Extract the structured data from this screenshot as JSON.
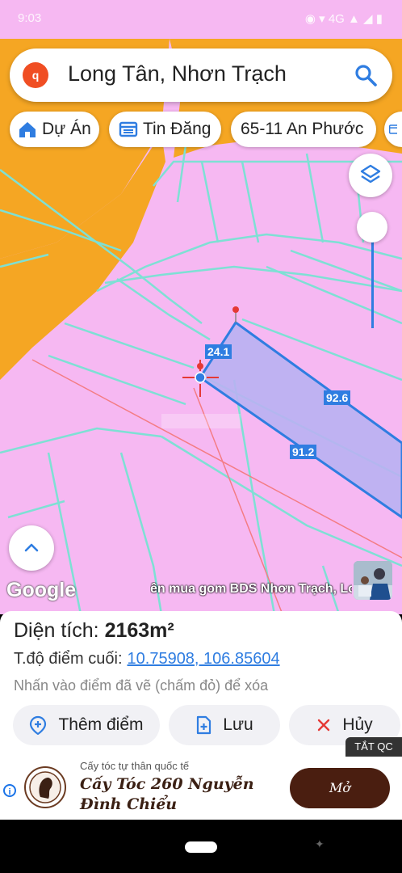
{
  "status_bar": {
    "time": "9:03",
    "signal": "4G",
    "right_text": "◉ ▾ 4G ▲ ◢ ▮"
  },
  "search": {
    "logo_letter": "q",
    "query": "Long Tân, Nhơn Trạch"
  },
  "chips": [
    {
      "label": "Dự Án",
      "icon": "home-icon"
    },
    {
      "label": "Tin Đăng",
      "icon": "listing-icon"
    },
    {
      "label": "65-11 An Phước",
      "icon": ""
    },
    {
      "label": "",
      "icon": "listing-icon"
    }
  ],
  "map": {
    "segments": [
      {
        "label": "24.1"
      },
      {
        "label": "92.6"
      },
      {
        "label": "91.2"
      }
    ],
    "google_label": "Google",
    "ticker": "ên mua gom BDS Nhơn Trạch, Lo",
    "colors": {
      "land": "#f6b8f2",
      "zone": "#f5a623",
      "parcel_fill": "#b9b1f2",
      "parcel_line": "#2f7de1",
      "cadastral": "#7ee0d4",
      "marker": "#e53935"
    }
  },
  "panel": {
    "area_label": "Diện tích:",
    "area_value": "2163m²",
    "coord_label": "T.độ điểm cuối:",
    "coord_value": "10.75908, 106.85604",
    "hint": "Nhấn vào điểm đã vẽ (chấm đỏ) để xóa",
    "buttons": {
      "add_point": "Thêm điểm",
      "save": "Lưu",
      "cancel": "Hủy"
    },
    "ad_off": "TẮT QC"
  },
  "ad": {
    "small_text": "Cấy tóc tự thân quốc tế",
    "headline": "Cấy Tóc 260 Nguyễn Đình Chiểu",
    "cta": "Mở",
    "info": "i"
  }
}
